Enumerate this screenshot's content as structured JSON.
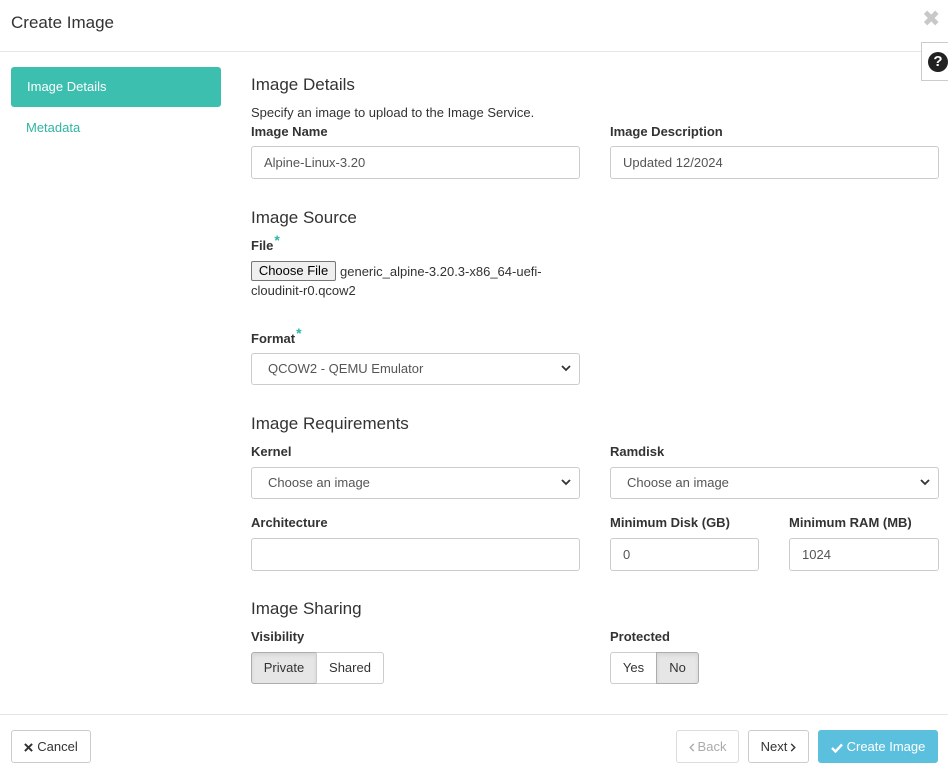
{
  "modal": {
    "title": "Create Image",
    "close_icon": "close-icon",
    "help_icon": "question-circle-icon"
  },
  "nav": {
    "items": [
      {
        "label": "Image Details",
        "active": true
      },
      {
        "label": "Metadata",
        "active": false
      }
    ]
  },
  "details": {
    "title": "Image Details",
    "help_text": "Specify an image to upload to the Image Service.",
    "image_name_label": "Image Name",
    "image_name_value": "Alpine-Linux-3.20",
    "image_description_label": "Image Description",
    "image_description_value": "Updated 12/2024"
  },
  "source": {
    "title": "Image Source",
    "file_label": "File",
    "required_mark": "*",
    "choose_file_label": "Choose File",
    "file_name": "generic_alpine-3.20.3-x86_64-uefi-cloudinit-r0.qcow2",
    "format_label": "Format",
    "format_value": "QCOW2 - QEMU Emulator"
  },
  "requirements": {
    "title": "Image Requirements",
    "kernel_label": "Kernel",
    "kernel_value": "Choose an image",
    "ramdisk_label": "Ramdisk",
    "ramdisk_value": "Choose an image",
    "architecture_label": "Architecture",
    "architecture_value": "",
    "min_disk_label": "Minimum Disk (GB)",
    "min_disk_value": "0",
    "min_ram_label": "Minimum RAM (MB)",
    "min_ram_value": "1024"
  },
  "sharing": {
    "title": "Image Sharing",
    "visibility_label": "Visibility",
    "visibility_options": [
      "Private",
      "Shared"
    ],
    "visibility_selected": "Private",
    "protected_label": "Protected",
    "protected_options": [
      "Yes",
      "No"
    ],
    "protected_selected": "No"
  },
  "footer": {
    "cancel_label": "Cancel",
    "back_label": "Back",
    "next_label": "Next",
    "create_label": "Create Image"
  },
  "colors": {
    "accent": "#3cbfaf",
    "primary_button": "#5bc0de"
  }
}
